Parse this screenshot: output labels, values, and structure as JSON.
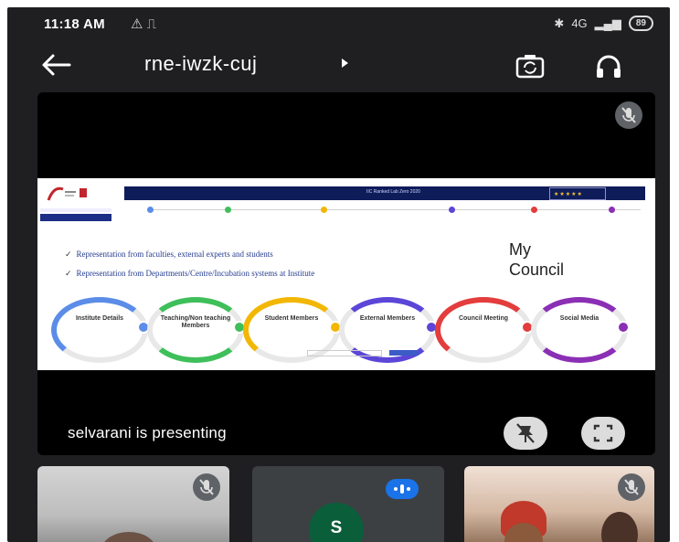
{
  "status_bar": {
    "time": "11:18 AM",
    "left_icons": "⚠ ⎍",
    "network": "4G",
    "battery": "89"
  },
  "top_bar": {
    "meeting_code": "rne-iwzk-cuj"
  },
  "presentation": {
    "slide": {
      "bar_title": "IIC Ranked Lab Zero 2020",
      "bullets": [
        "Representation from faculties, external experts and students",
        "Representation from Departments/Centre/Incubation systems at Institute"
      ],
      "heading_line1": "My",
      "heading_line2": "Council",
      "steps": [
        {
          "label": "Institute Details",
          "color": "#5b8de8"
        },
        {
          "label": "Teaching/Non teaching Members",
          "color": "#3fbf5a"
        },
        {
          "label": "Student Members",
          "color": "#f2b705"
        },
        {
          "label": "External Members",
          "color": "#5b46d8"
        },
        {
          "label": "Council Meeting",
          "color": "#e33d3d"
        },
        {
          "label": "Social Media",
          "color": "#8b2fb5"
        }
      ]
    },
    "presenting_text": "selvarani is presenting"
  },
  "participants": [
    {
      "name": "camera-participant-1",
      "muted": true
    },
    {
      "initial": "S",
      "speaking": true
    },
    {
      "name": "camera-participant-3",
      "muted": true
    }
  ],
  "colors": {
    "background": "#1f1f22",
    "speaking_accent": "#1a73e8",
    "avatar_bg": "#0b5e3a"
  }
}
